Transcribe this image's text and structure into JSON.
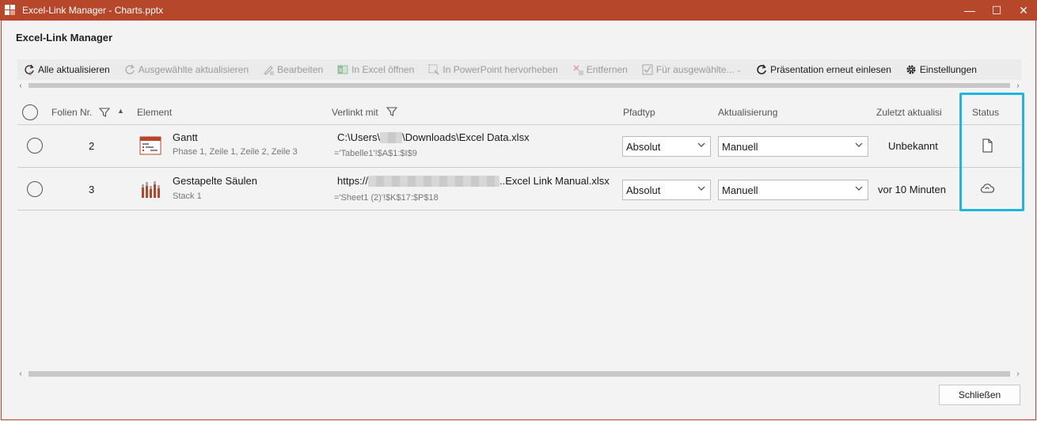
{
  "window": {
    "title": "Excel-Link Manager - Charts.pptx",
    "minimize": "—",
    "maximize": "☐",
    "close": "✕",
    "accent": "#b7472a"
  },
  "heading": "Excel-Link Manager",
  "toolbar": {
    "items": [
      {
        "label": "Alle aktualisieren",
        "icon": "refresh-all-icon",
        "enabled": true
      },
      {
        "label": "Ausgewählte aktualisieren",
        "icon": "refresh-icon",
        "enabled": false
      },
      {
        "label": "Bearbeiten",
        "icon": "edit-icon",
        "enabled": false
      },
      {
        "label": "In Excel öffnen",
        "icon": "excel-icon",
        "enabled": false
      },
      {
        "label": "In PowerPoint hervorheben",
        "icon": "highlight-icon",
        "enabled": false
      },
      {
        "label": "Entfernen",
        "icon": "remove-icon",
        "enabled": false
      },
      {
        "label": "Für ausgewählte...",
        "icon": "checklist-icon",
        "enabled": false
      },
      {
        "label": "Präsentation erneut einlesen",
        "icon": "reload-icon",
        "enabled": true
      },
      {
        "label": "Einstellungen",
        "icon": "gear-icon",
        "enabled": true
      }
    ]
  },
  "table": {
    "headers": {
      "slide": "Folien Nr.",
      "element": "Element",
      "linked": "Verlinkt mit",
      "pathtype": "Pfadtyp",
      "update": "Aktualisierung",
      "last": "Zuletzt aktualisi",
      "status": "Status"
    },
    "rows": [
      {
        "slide": "2",
        "element": "Gantt",
        "element_sub": "Phase 1, Zeile 1, Zeile 2, Zeile 3",
        "link_prefix": "C:\\Users\\",
        "link_suffix": "\\Downloads\\Excel Data.xlsx",
        "link_range": "='Tabelle1'!$A$1:$I$9",
        "pathtype": "Absolut",
        "update": "Manuell",
        "last": "Unbekannt",
        "status_icon": "file-icon"
      },
      {
        "slide": "3",
        "element": "Gestapelte Säulen",
        "element_sub": "Stack 1",
        "link_prefix": "https://",
        "link_suffix": "..Excel Link Manual.xlsx",
        "link_range": "='Sheet1 (2)'!$K$17:$P$18",
        "pathtype": "Absolut",
        "update": "Manuell",
        "last": "vor 10 Minuten",
        "status_icon": "cloud-sync-icon"
      }
    ]
  },
  "close_button": "Schließen",
  "highlight_color": "#1fb5dd"
}
